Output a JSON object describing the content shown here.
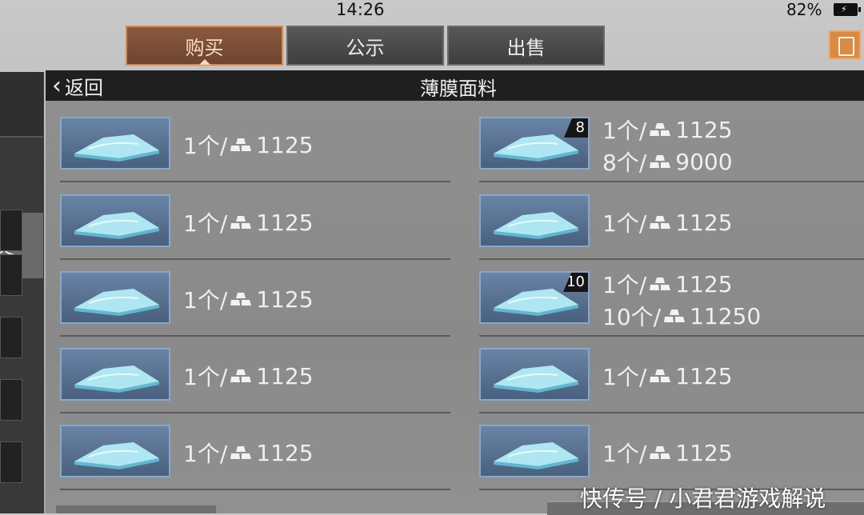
{
  "status_bar": {
    "time": "14:26",
    "battery_percent": "82%",
    "battery_icon": "battery-charging-icon"
  },
  "tabs": [
    {
      "label": "购买",
      "active": true
    },
    {
      "label": "公示",
      "active": false
    },
    {
      "label": "出售",
      "active": false
    }
  ],
  "clipboard_icon": "clipboard-icon",
  "sidebar": {
    "category_label": "类"
  },
  "header": {
    "back_label": "返回",
    "title": "薄膜面料"
  },
  "listings": [
    {
      "badge": "",
      "line1": {
        "qty": "1个/",
        "price": "1125"
      },
      "line2": null
    },
    {
      "badge": "8",
      "line1": {
        "qty": "1个/",
        "price": "1125"
      },
      "line2": {
        "qty": "8个/",
        "price": "9000"
      }
    },
    {
      "badge": "",
      "line1": {
        "qty": "1个/",
        "price": "1125"
      },
      "line2": null
    },
    {
      "badge": "",
      "line1": {
        "qty": "1个/",
        "price": "1125"
      },
      "line2": null
    },
    {
      "badge": "",
      "line1": {
        "qty": "1个/",
        "price": "1125"
      },
      "line2": null
    },
    {
      "badge": "10",
      "line1": {
        "qty": "1个/",
        "price": "1125"
      },
      "line2": {
        "qty": "10个/",
        "price": "11250"
      }
    },
    {
      "badge": "",
      "line1": {
        "qty": "1个/",
        "price": "1125"
      },
      "line2": null
    },
    {
      "badge": "",
      "line1": {
        "qty": "1个/",
        "price": "1125"
      },
      "line2": null
    },
    {
      "badge": "",
      "line1": {
        "qty": "1个/",
        "price": "1125"
      },
      "line2": null
    },
    {
      "badge": "",
      "line1": {
        "qty": "1个/",
        "price": "1125"
      },
      "line2": null
    }
  ],
  "currency_icon": "gold-bars-icon",
  "watermark": "快传号 / 小君君游戏解说"
}
